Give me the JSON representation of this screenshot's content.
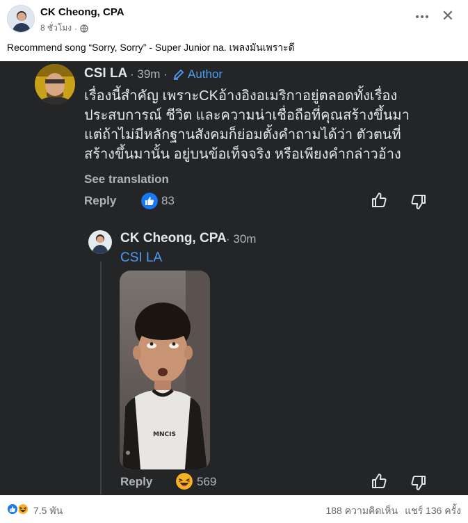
{
  "post": {
    "author": "CK Cheong, CPA",
    "time": "8 ชั่วโมง",
    "audience_icon": "globe-icon",
    "caption": "Recommend song “Sorry, Sorry” - Super Junior na. เพลงมันเพราะดี"
  },
  "screenshot": {
    "comment": {
      "author": "CSI LA",
      "time": "· 39m ·",
      "badge": "Author",
      "lines": [
        "เรื่องนี้สำคัญ เพราะCKอ้างอิงอเมริกาอยู่ตลอดทั้งเรื่อง",
        "ประสบการณ์ ชีวิต และความน่าเชื่อถือที่คุณสร้างขึ้นมา",
        "แต่ถ้าไม่มีหลักฐานสังคมก็ย่อมตั้งคำถามได้ว่า ตัวตนที่",
        "สร้างขึ้นมานั้น อยู่บนข้อเท็จจริง หรือเพียงคำกล่าวอ้าง"
      ],
      "see_translation": "See translation",
      "reply_label": "Reply",
      "reaction_icon": "like-icon",
      "reaction_count": "83"
    },
    "reply": {
      "author": "CK Cheong, CPA",
      "time": "· 30m",
      "mention": "CSI LA",
      "photo_caption": "MNCIS",
      "reply_label": "Reply",
      "reaction_icon": "haha-icon",
      "reaction_count": "569"
    }
  },
  "footer": {
    "reaction_count": "7.5 พัน",
    "comments": "188 ความคิดเห็น",
    "shares": "แชร์ 136 ครั้ง"
  },
  "colors": {
    "dark_bg": "#242526",
    "link_blue": "#4e9cf5",
    "like_blue": "#1877f2",
    "haha_yellow": "#f7b125"
  }
}
